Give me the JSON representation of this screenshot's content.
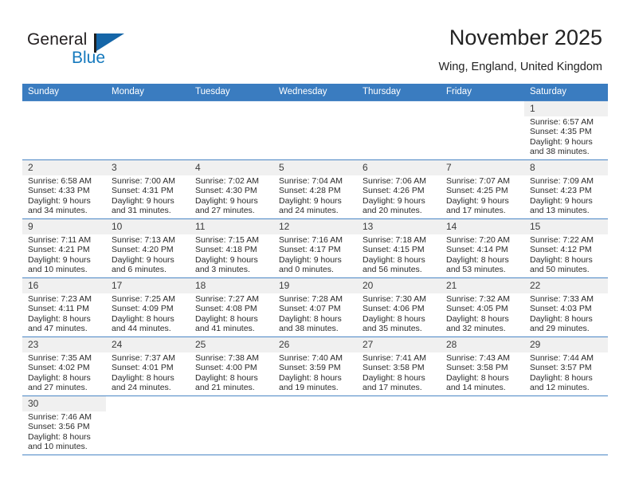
{
  "brand": {
    "name_part1": "General",
    "name_part2": "Blue",
    "flag_icon": "blue-triangle-flag-icon",
    "colors": {
      "dark": "#231f20",
      "blue": "#1579bd"
    }
  },
  "header": {
    "title": "November 2025",
    "subtitle": "Wing, England, United Kingdom"
  },
  "calendar": {
    "accent_color": "#3a7cc0",
    "daynum_background": "#f0f0f0",
    "weekdays": [
      "Sunday",
      "Monday",
      "Tuesday",
      "Wednesday",
      "Thursday",
      "Friday",
      "Saturday"
    ],
    "weeks": [
      [
        {
          "day": "",
          "sunrise": "",
          "sunset": "",
          "daylight_line1": "",
          "daylight_line2": ""
        },
        {
          "day": "",
          "sunrise": "",
          "sunset": "",
          "daylight_line1": "",
          "daylight_line2": ""
        },
        {
          "day": "",
          "sunrise": "",
          "sunset": "",
          "daylight_line1": "",
          "daylight_line2": ""
        },
        {
          "day": "",
          "sunrise": "",
          "sunset": "",
          "daylight_line1": "",
          "daylight_line2": ""
        },
        {
          "day": "",
          "sunrise": "",
          "sunset": "",
          "daylight_line1": "",
          "daylight_line2": ""
        },
        {
          "day": "",
          "sunrise": "",
          "sunset": "",
          "daylight_line1": "",
          "daylight_line2": ""
        },
        {
          "day": "1",
          "sunrise": "Sunrise: 6:57 AM",
          "sunset": "Sunset: 4:35 PM",
          "daylight_line1": "Daylight: 9 hours",
          "daylight_line2": "and 38 minutes."
        }
      ],
      [
        {
          "day": "2",
          "sunrise": "Sunrise: 6:58 AM",
          "sunset": "Sunset: 4:33 PM",
          "daylight_line1": "Daylight: 9 hours",
          "daylight_line2": "and 34 minutes."
        },
        {
          "day": "3",
          "sunrise": "Sunrise: 7:00 AM",
          "sunset": "Sunset: 4:31 PM",
          "daylight_line1": "Daylight: 9 hours",
          "daylight_line2": "and 31 minutes."
        },
        {
          "day": "4",
          "sunrise": "Sunrise: 7:02 AM",
          "sunset": "Sunset: 4:30 PM",
          "daylight_line1": "Daylight: 9 hours",
          "daylight_line2": "and 27 minutes."
        },
        {
          "day": "5",
          "sunrise": "Sunrise: 7:04 AM",
          "sunset": "Sunset: 4:28 PM",
          "daylight_line1": "Daylight: 9 hours",
          "daylight_line2": "and 24 minutes."
        },
        {
          "day": "6",
          "sunrise": "Sunrise: 7:06 AM",
          "sunset": "Sunset: 4:26 PM",
          "daylight_line1": "Daylight: 9 hours",
          "daylight_line2": "and 20 minutes."
        },
        {
          "day": "7",
          "sunrise": "Sunrise: 7:07 AM",
          "sunset": "Sunset: 4:25 PM",
          "daylight_line1": "Daylight: 9 hours",
          "daylight_line2": "and 17 minutes."
        },
        {
          "day": "8",
          "sunrise": "Sunrise: 7:09 AM",
          "sunset": "Sunset: 4:23 PM",
          "daylight_line1": "Daylight: 9 hours",
          "daylight_line2": "and 13 minutes."
        }
      ],
      [
        {
          "day": "9",
          "sunrise": "Sunrise: 7:11 AM",
          "sunset": "Sunset: 4:21 PM",
          "daylight_line1": "Daylight: 9 hours",
          "daylight_line2": "and 10 minutes."
        },
        {
          "day": "10",
          "sunrise": "Sunrise: 7:13 AM",
          "sunset": "Sunset: 4:20 PM",
          "daylight_line1": "Daylight: 9 hours",
          "daylight_line2": "and 6 minutes."
        },
        {
          "day": "11",
          "sunrise": "Sunrise: 7:15 AM",
          "sunset": "Sunset: 4:18 PM",
          "daylight_line1": "Daylight: 9 hours",
          "daylight_line2": "and 3 minutes."
        },
        {
          "day": "12",
          "sunrise": "Sunrise: 7:16 AM",
          "sunset": "Sunset: 4:17 PM",
          "daylight_line1": "Daylight: 9 hours",
          "daylight_line2": "and 0 minutes."
        },
        {
          "day": "13",
          "sunrise": "Sunrise: 7:18 AM",
          "sunset": "Sunset: 4:15 PM",
          "daylight_line1": "Daylight: 8 hours",
          "daylight_line2": "and 56 minutes."
        },
        {
          "day": "14",
          "sunrise": "Sunrise: 7:20 AM",
          "sunset": "Sunset: 4:14 PM",
          "daylight_line1": "Daylight: 8 hours",
          "daylight_line2": "and 53 minutes."
        },
        {
          "day": "15",
          "sunrise": "Sunrise: 7:22 AM",
          "sunset": "Sunset: 4:12 PM",
          "daylight_line1": "Daylight: 8 hours",
          "daylight_line2": "and 50 minutes."
        }
      ],
      [
        {
          "day": "16",
          "sunrise": "Sunrise: 7:23 AM",
          "sunset": "Sunset: 4:11 PM",
          "daylight_line1": "Daylight: 8 hours",
          "daylight_line2": "and 47 minutes."
        },
        {
          "day": "17",
          "sunrise": "Sunrise: 7:25 AM",
          "sunset": "Sunset: 4:09 PM",
          "daylight_line1": "Daylight: 8 hours",
          "daylight_line2": "and 44 minutes."
        },
        {
          "day": "18",
          "sunrise": "Sunrise: 7:27 AM",
          "sunset": "Sunset: 4:08 PM",
          "daylight_line1": "Daylight: 8 hours",
          "daylight_line2": "and 41 minutes."
        },
        {
          "day": "19",
          "sunrise": "Sunrise: 7:28 AM",
          "sunset": "Sunset: 4:07 PM",
          "daylight_line1": "Daylight: 8 hours",
          "daylight_line2": "and 38 minutes."
        },
        {
          "day": "20",
          "sunrise": "Sunrise: 7:30 AM",
          "sunset": "Sunset: 4:06 PM",
          "daylight_line1": "Daylight: 8 hours",
          "daylight_line2": "and 35 minutes."
        },
        {
          "day": "21",
          "sunrise": "Sunrise: 7:32 AM",
          "sunset": "Sunset: 4:05 PM",
          "daylight_line1": "Daylight: 8 hours",
          "daylight_line2": "and 32 minutes."
        },
        {
          "day": "22",
          "sunrise": "Sunrise: 7:33 AM",
          "sunset": "Sunset: 4:03 PM",
          "daylight_line1": "Daylight: 8 hours",
          "daylight_line2": "and 29 minutes."
        }
      ],
      [
        {
          "day": "23",
          "sunrise": "Sunrise: 7:35 AM",
          "sunset": "Sunset: 4:02 PM",
          "daylight_line1": "Daylight: 8 hours",
          "daylight_line2": "and 27 minutes."
        },
        {
          "day": "24",
          "sunrise": "Sunrise: 7:37 AM",
          "sunset": "Sunset: 4:01 PM",
          "daylight_line1": "Daylight: 8 hours",
          "daylight_line2": "and 24 minutes."
        },
        {
          "day": "25",
          "sunrise": "Sunrise: 7:38 AM",
          "sunset": "Sunset: 4:00 PM",
          "daylight_line1": "Daylight: 8 hours",
          "daylight_line2": "and 21 minutes."
        },
        {
          "day": "26",
          "sunrise": "Sunrise: 7:40 AM",
          "sunset": "Sunset: 3:59 PM",
          "daylight_line1": "Daylight: 8 hours",
          "daylight_line2": "and 19 minutes."
        },
        {
          "day": "27",
          "sunrise": "Sunrise: 7:41 AM",
          "sunset": "Sunset: 3:58 PM",
          "daylight_line1": "Daylight: 8 hours",
          "daylight_line2": "and 17 minutes."
        },
        {
          "day": "28",
          "sunrise": "Sunrise: 7:43 AM",
          "sunset": "Sunset: 3:58 PM",
          "daylight_line1": "Daylight: 8 hours",
          "daylight_line2": "and 14 minutes."
        },
        {
          "day": "29",
          "sunrise": "Sunrise: 7:44 AM",
          "sunset": "Sunset: 3:57 PM",
          "daylight_line1": "Daylight: 8 hours",
          "daylight_line2": "and 12 minutes."
        }
      ],
      [
        {
          "day": "30",
          "sunrise": "Sunrise: 7:46 AM",
          "sunset": "Sunset: 3:56 PM",
          "daylight_line1": "Daylight: 8 hours",
          "daylight_line2": "and 10 minutes."
        },
        {
          "day": "",
          "sunrise": "",
          "sunset": "",
          "daylight_line1": "",
          "daylight_line2": ""
        },
        {
          "day": "",
          "sunrise": "",
          "sunset": "",
          "daylight_line1": "",
          "daylight_line2": ""
        },
        {
          "day": "",
          "sunrise": "",
          "sunset": "",
          "daylight_line1": "",
          "daylight_line2": ""
        },
        {
          "day": "",
          "sunrise": "",
          "sunset": "",
          "daylight_line1": "",
          "daylight_line2": ""
        },
        {
          "day": "",
          "sunrise": "",
          "sunset": "",
          "daylight_line1": "",
          "daylight_line2": ""
        },
        {
          "day": "",
          "sunrise": "",
          "sunset": "",
          "daylight_line1": "",
          "daylight_line2": ""
        }
      ]
    ]
  }
}
